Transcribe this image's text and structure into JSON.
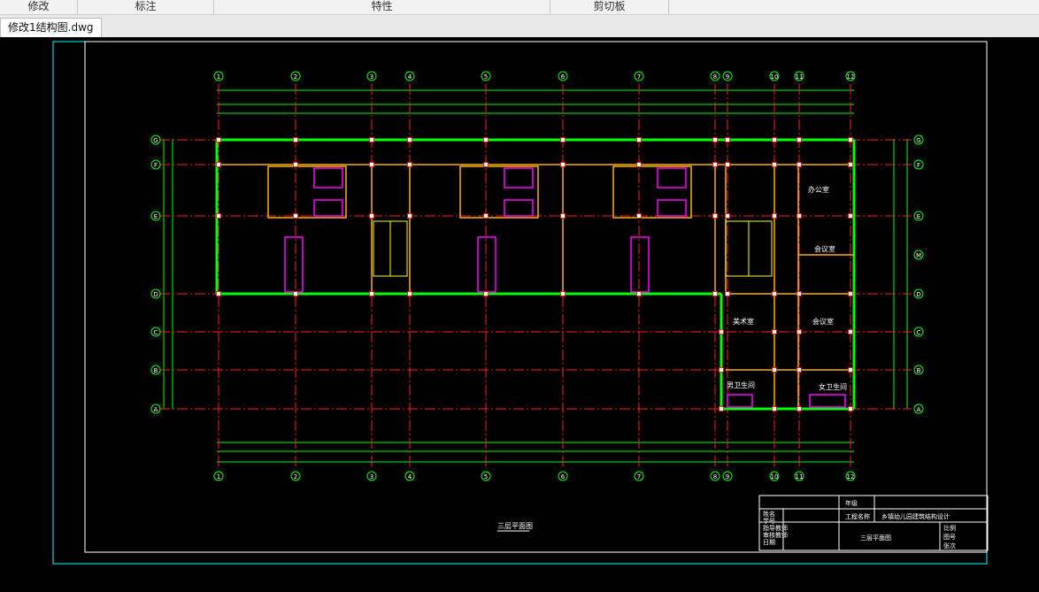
{
  "ribbon": {
    "groups": [
      "修改",
      "标注",
      "特性",
      "剪切板"
    ]
  },
  "document_tab": {
    "label": "修改1结构图.dwg"
  },
  "drawing": {
    "axis_numbers": [
      "1",
      "2",
      "3",
      "4",
      "5",
      "6",
      "7",
      "8",
      "9",
      "10",
      "11",
      "12"
    ],
    "axis_letters": [
      "G",
      "F",
      "E",
      "D",
      "C",
      "B",
      "A"
    ],
    "right_axis_letters": [
      "G",
      "F",
      "E",
      "M",
      "D",
      "C",
      "B",
      "A"
    ],
    "rooms": {
      "office": "办公室",
      "meeting_upper": "会议室",
      "meeting_lower": "会议室",
      "art_room": "美术室",
      "male_wc": "男卫生间",
      "female_wc": "女卫生间"
    },
    "plan_title": "三层平面图",
    "title_block": {
      "year": "年级",
      "project_label": "工程名称",
      "project_name": "乡镇幼儿园建筑结构设计",
      "drawing_name": "三层平面图",
      "rows_left": [
        "姓名",
        "学号",
        "指导教师",
        "审核教师",
        "日期"
      ],
      "rows_right": [
        "比例",
        "图号",
        "张次"
      ]
    }
  },
  "colors": {
    "green": "#00ff00",
    "red_axis": "#ff0000",
    "yellow": "#ffff00",
    "magenta": "#ff00ff",
    "cyan_frame": "#00ffff",
    "white": "#ffffff",
    "orange_wall": "#ffb000"
  }
}
